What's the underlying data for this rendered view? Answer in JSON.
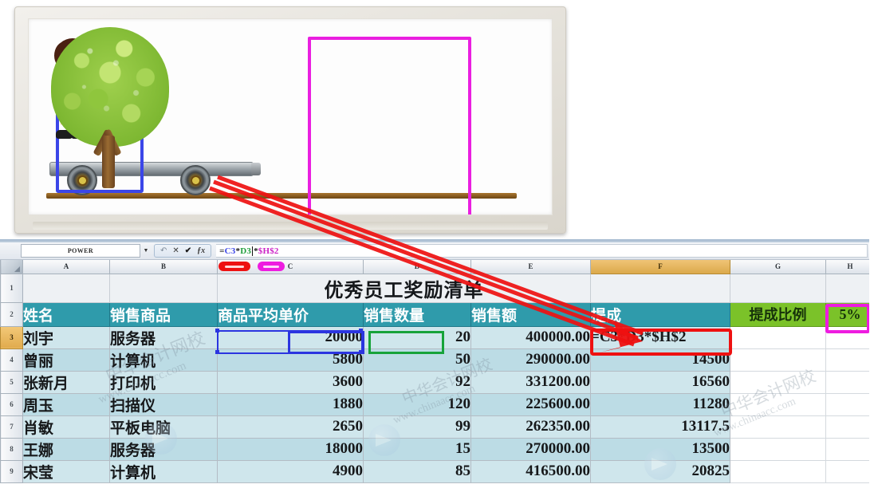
{
  "illustration": {
    "alt": "cartoon girl on a flat cart and a green tree",
    "girl_box_color": "#3b46e8",
    "tree_box_color": "#ea1fe0",
    "arrow_color": "#ee1111"
  },
  "excel": {
    "name_box": "POWER",
    "formula": {
      "full": "=C3*D3*$H$2",
      "segments": [
        {
          "text": "=",
          "color": "#1a1a1a"
        },
        {
          "text": "C3",
          "color": "#3b46e8"
        },
        {
          "text": "*",
          "color": "#1a1a1a"
        },
        {
          "text": "D3",
          "color": "#1f9d3b"
        },
        {
          "text": "*",
          "color": "#1a1a1a"
        },
        {
          "text": "$H$2",
          "color": "#cc22c6"
        }
      ]
    },
    "toolbar_icons": [
      "undo-icon",
      "cancel-icon",
      "confirm-icon",
      "function-icon"
    ],
    "column_headers": [
      "A",
      "B",
      "C",
      "D",
      "E",
      "F",
      "G",
      "H"
    ],
    "selected_column": "F",
    "row_headers": [
      "1",
      "2",
      "3",
      "4",
      "5",
      "6",
      "7",
      "8",
      "9"
    ],
    "selected_row": "3",
    "title": "优秀员工奖励清单",
    "table_headers": [
      "姓名",
      "销售商品",
      "商品平均单价",
      "销售数量",
      "销售额",
      "提成"
    ],
    "rate_label": "提成比例",
    "rate_value": "5%",
    "rows": [
      {
        "row": "3",
        "name": "刘宇",
        "product": "服务器",
        "price": "20000",
        "qty": "20",
        "amount": "400000.00",
        "bonus": "=C3*D3*$H$2"
      },
      {
        "row": "4",
        "name": "曾丽",
        "product": "计算机",
        "price": "5800",
        "qty": "50",
        "amount": "290000.00",
        "bonus": "14500"
      },
      {
        "row": "5",
        "name": "张新月",
        "product": "打印机",
        "price": "3600",
        "qty": "92",
        "amount": "331200.00",
        "bonus": "16560"
      },
      {
        "row": "6",
        "name": "周玉",
        "product": "扫描仪",
        "price": "1880",
        "qty": "120",
        "amount": "225600.00",
        "bonus": "11280"
      },
      {
        "row": "7",
        "name": "肖敏",
        "product": "平板电脑",
        "price": "2650",
        "qty": "99",
        "amount": "262350.00",
        "bonus": "13117.5"
      },
      {
        "row": "8",
        "name": "王娜",
        "product": "服务器",
        "price": "18000",
        "qty": "15",
        "amount": "270000.00",
        "bonus": "13500"
      },
      {
        "row": "9",
        "name": "宋莹",
        "product": "计算机",
        "price": "4900",
        "qty": "85",
        "amount": "416500.00",
        "bonus": "20825"
      }
    ],
    "highlights": {
      "c3_color": "#2b35e0",
      "d3_color": "#17a33a",
      "f3_color": "#ee1111",
      "h2_color": "#ee1ce0"
    },
    "watermark_text": "中华会计网校",
    "watermark_url": "www.chinaacc.com"
  }
}
